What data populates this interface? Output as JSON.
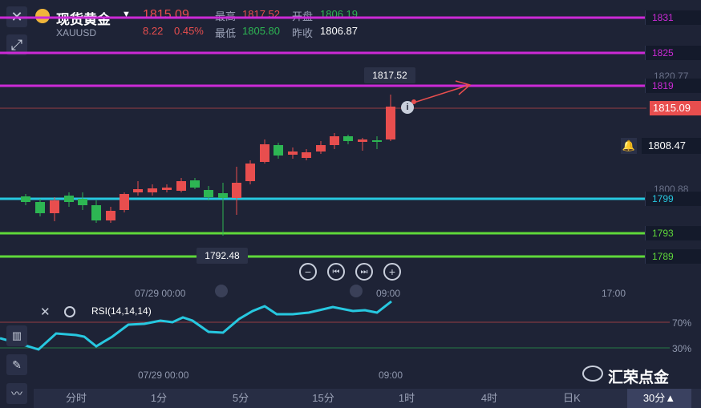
{
  "instrument": {
    "name": "现货黄金",
    "symbol": "XAUUSD",
    "last": "1815.09",
    "change": "8.22",
    "change_pct": "0.45%",
    "high_label": "最高",
    "high": "1817.52",
    "low_label": "最低",
    "low": "1805.80",
    "open_label": "开盘",
    "open": "1806.19",
    "prev_close_label": "昨收",
    "prev_close": "1806.87"
  },
  "price_axis": {
    "current_tag": "1815.09",
    "alert_tag": "1808.47",
    "tick_1820": "1820.77",
    "tick_1800": "1800.88"
  },
  "levels": [
    {
      "label": "1831",
      "color": "#cc2ad6"
    },
    {
      "label": "1825",
      "color": "#cc2ad6"
    },
    {
      "label": "1819",
      "color": "#cc2ad6"
    },
    {
      "label": "1799",
      "color": "#27c8e0"
    },
    {
      "label": "1793",
      "color": "#5fd83a"
    },
    {
      "label": "1789",
      "color": "#5fd83a"
    }
  ],
  "callouts": {
    "high_marker": "1817.52",
    "low_marker": "1792.48"
  },
  "time_axis": [
    "07/29 00:00",
    "09:00",
    "17:00"
  ],
  "rsi": {
    "label": "RSI(14,14,14)",
    "level_high": "70%",
    "level_low": "30%",
    "time_axis": [
      "07/29 00:00",
      "09:00"
    ]
  },
  "timeframe_tabs": [
    "分时",
    "1分",
    "5分",
    "15分",
    "1时",
    "4时",
    "日K",
    "30分▲"
  ],
  "active_tab_index": 7,
  "watermark": "汇荣点金",
  "colors": {
    "up": "#e84e4e",
    "down": "#2db653",
    "rsi": "#27c8e0"
  }
}
